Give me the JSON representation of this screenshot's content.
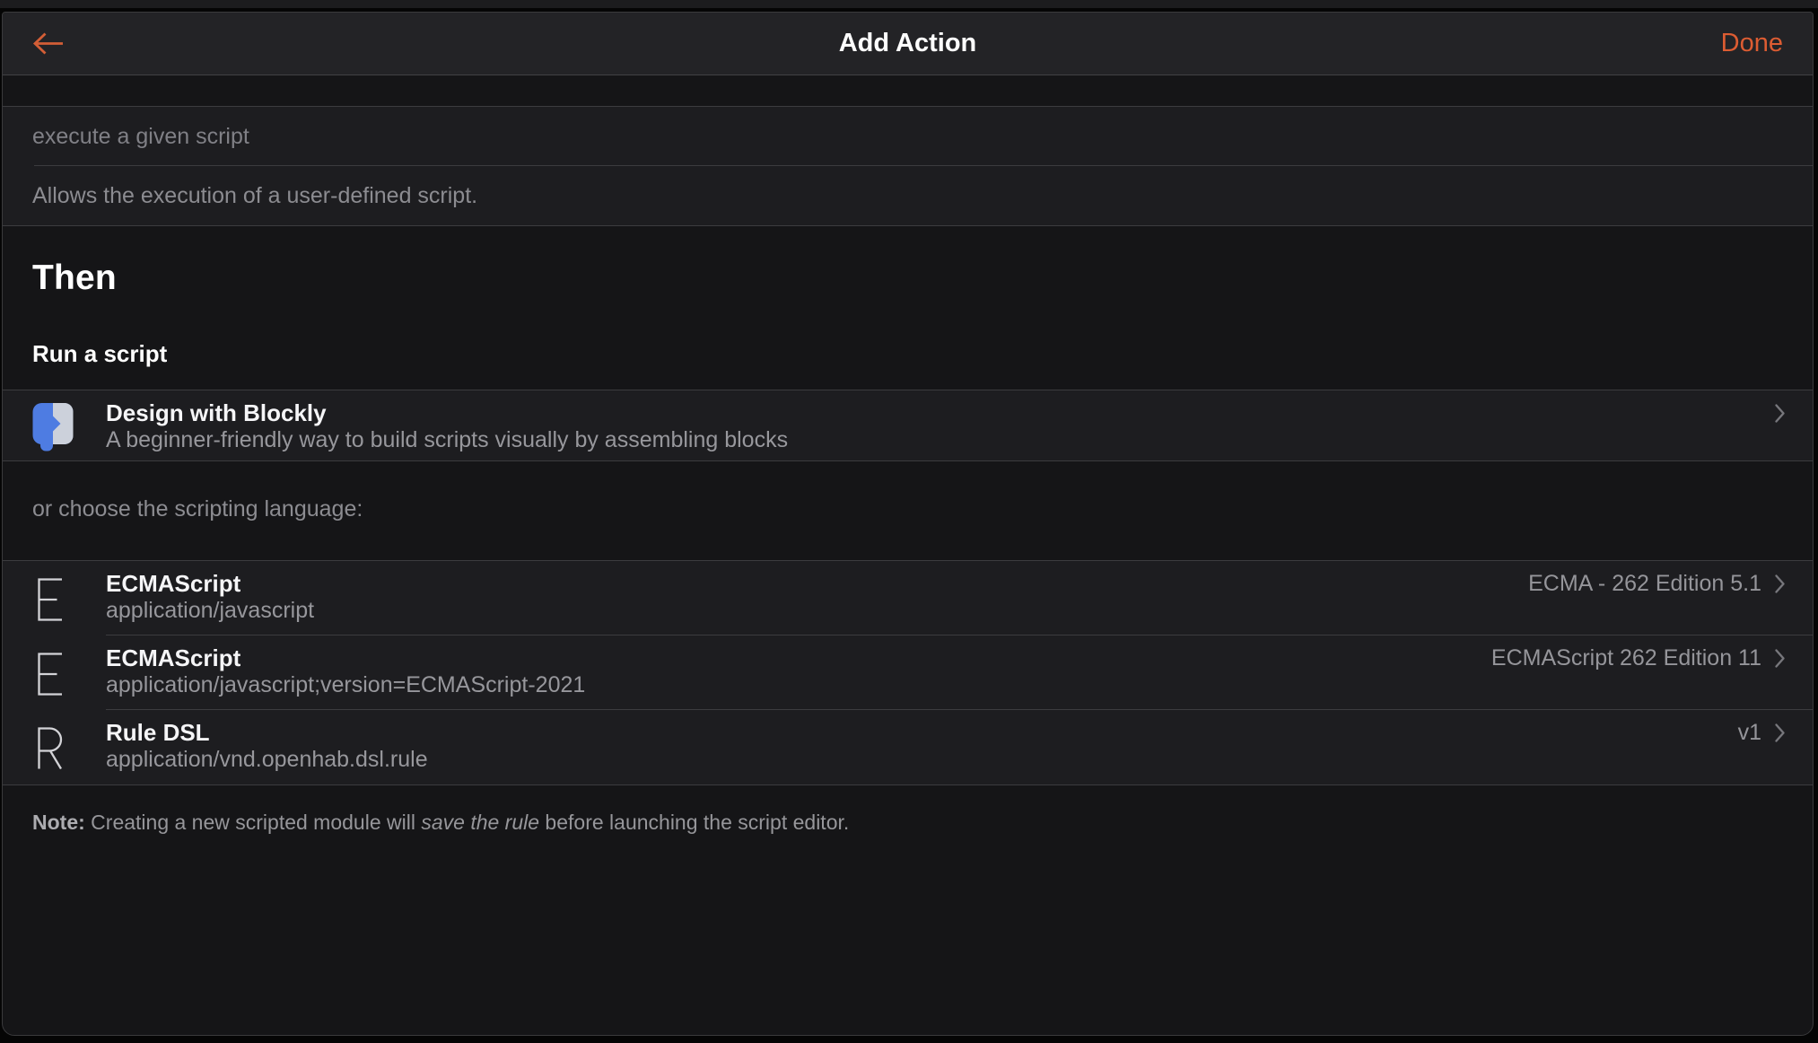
{
  "colors": {
    "accent": "#dc5c32",
    "page-bg": "#151517",
    "card-bg": "#1d1d20",
    "navbar-bg": "#232326",
    "blockly-blue": "#4e7ce2",
    "blockly-light": "#ccd1db"
  },
  "navbar": {
    "title": "Add Action",
    "done_label": "Done"
  },
  "module": {
    "name_value": "execute a given script",
    "description": "Allows the execution of a user-defined script."
  },
  "section": {
    "heading": "Then",
    "subheading": "Run a script"
  },
  "blockly": {
    "title": "Design with Blockly",
    "subtitle": "A beginner-friendly way to build scripts visually by assembling blocks"
  },
  "or_choose_label": "or choose the scripting language:",
  "languages": [
    {
      "icon_letter": "E",
      "title": "ECMAScript",
      "mime": "application/javascript",
      "version": "ECMA - 262 Edition 5.1"
    },
    {
      "icon_letter": "E",
      "title": "ECMAScript",
      "mime": "application/javascript;version=ECMAScript-2021",
      "version": "ECMAScript 262 Edition 11"
    },
    {
      "icon_letter": "R",
      "title": "Rule DSL",
      "mime": "application/vnd.openhab.dsl.rule",
      "version": "v1"
    }
  ],
  "note": {
    "label": "Note:",
    "before": " Creating a new scripted module will ",
    "italic": "save the rule",
    "after": " before launching the script editor."
  }
}
